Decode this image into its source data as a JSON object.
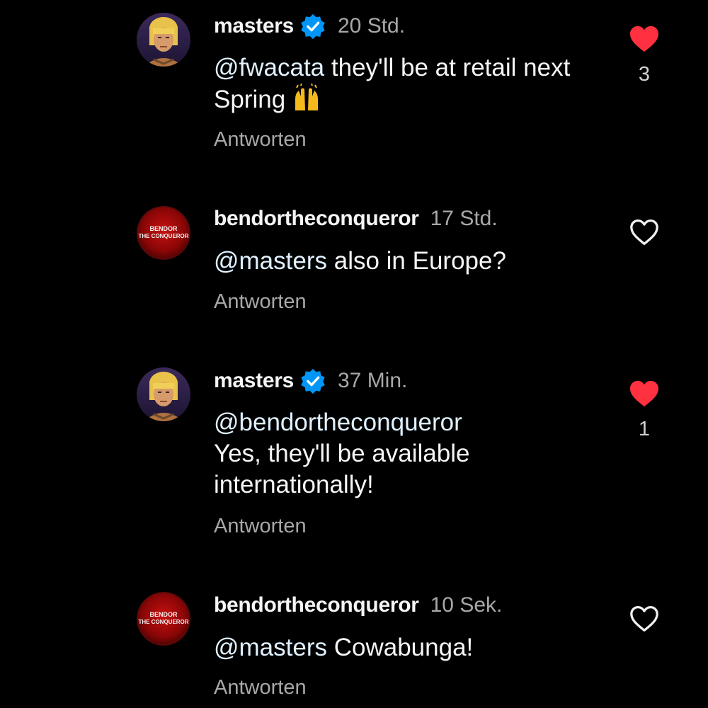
{
  "comments": [
    {
      "username": "masters",
      "verified": true,
      "time": "20 Std.",
      "mention": "@fwacata",
      "text": " they'll be at retail next Spring",
      "emoji": "raising-hands",
      "reply_label": "Antworten",
      "liked": true,
      "like_count": "3"
    },
    {
      "username": "bendortheconqueror",
      "avatar_text_top": "BENDOR",
      "avatar_text_bottom": "THE CONQUEROR",
      "time": "17 Std.",
      "mention": "@masters",
      "text": " also in Europe?",
      "reply_label": "Antworten",
      "liked": false
    },
    {
      "username": "masters",
      "verified": true,
      "time": "37 Min.",
      "mention": "@bendortheconqueror",
      "text_line2": "Yes, they'll be available",
      "text_line3": "internationally!",
      "reply_label": "Antworten",
      "liked": true,
      "like_count": "1"
    },
    {
      "username": "bendortheconqueror",
      "avatar_text_top": "BENDOR",
      "avatar_text_bottom": "THE CONQUEROR",
      "time": "10 Sek.",
      "mention": "@masters",
      "text": " Cowabunga!",
      "reply_label": "Antworten",
      "liked": false
    }
  ],
  "colors": {
    "background": "#000000",
    "like_red": "#ff3040",
    "verified_blue": "#0095f6",
    "muted_text": "#a8a8a8",
    "mention": "#e0f1ff"
  }
}
